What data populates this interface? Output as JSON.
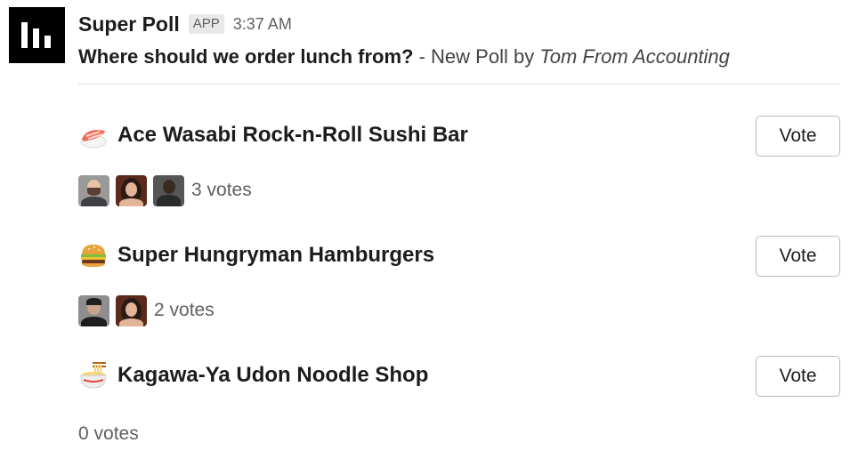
{
  "app": {
    "name": "Super Poll",
    "badge": "APP",
    "timestamp": "3:37 AM"
  },
  "poll": {
    "question": "Where should we order lunch from?",
    "separator": " - ",
    "by_label": "New Poll by ",
    "author": "Tom From Accounting"
  },
  "options": [
    {
      "emoji": "sushi-icon",
      "name": "Ace Wasabi Rock-n-Roll Sushi Bar",
      "vote_label": "Vote",
      "votes_text": "3 votes",
      "votes": 3
    },
    {
      "emoji": "hamburger-icon",
      "name": "Super Hungryman Hamburgers",
      "vote_label": "Vote",
      "votes_text": "2 votes",
      "votes": 2
    },
    {
      "emoji": "noodle-bowl-icon",
      "name": "Kagawa-Ya Udon Noodle Shop",
      "vote_label": "Vote",
      "votes_text": "0 votes",
      "votes": 0
    }
  ],
  "colors": {
    "logo_bg": "#000000",
    "text": "#1d1c1d",
    "muted": "#616061",
    "divider": "#dddddd",
    "button_border": "#bbbbbb"
  }
}
